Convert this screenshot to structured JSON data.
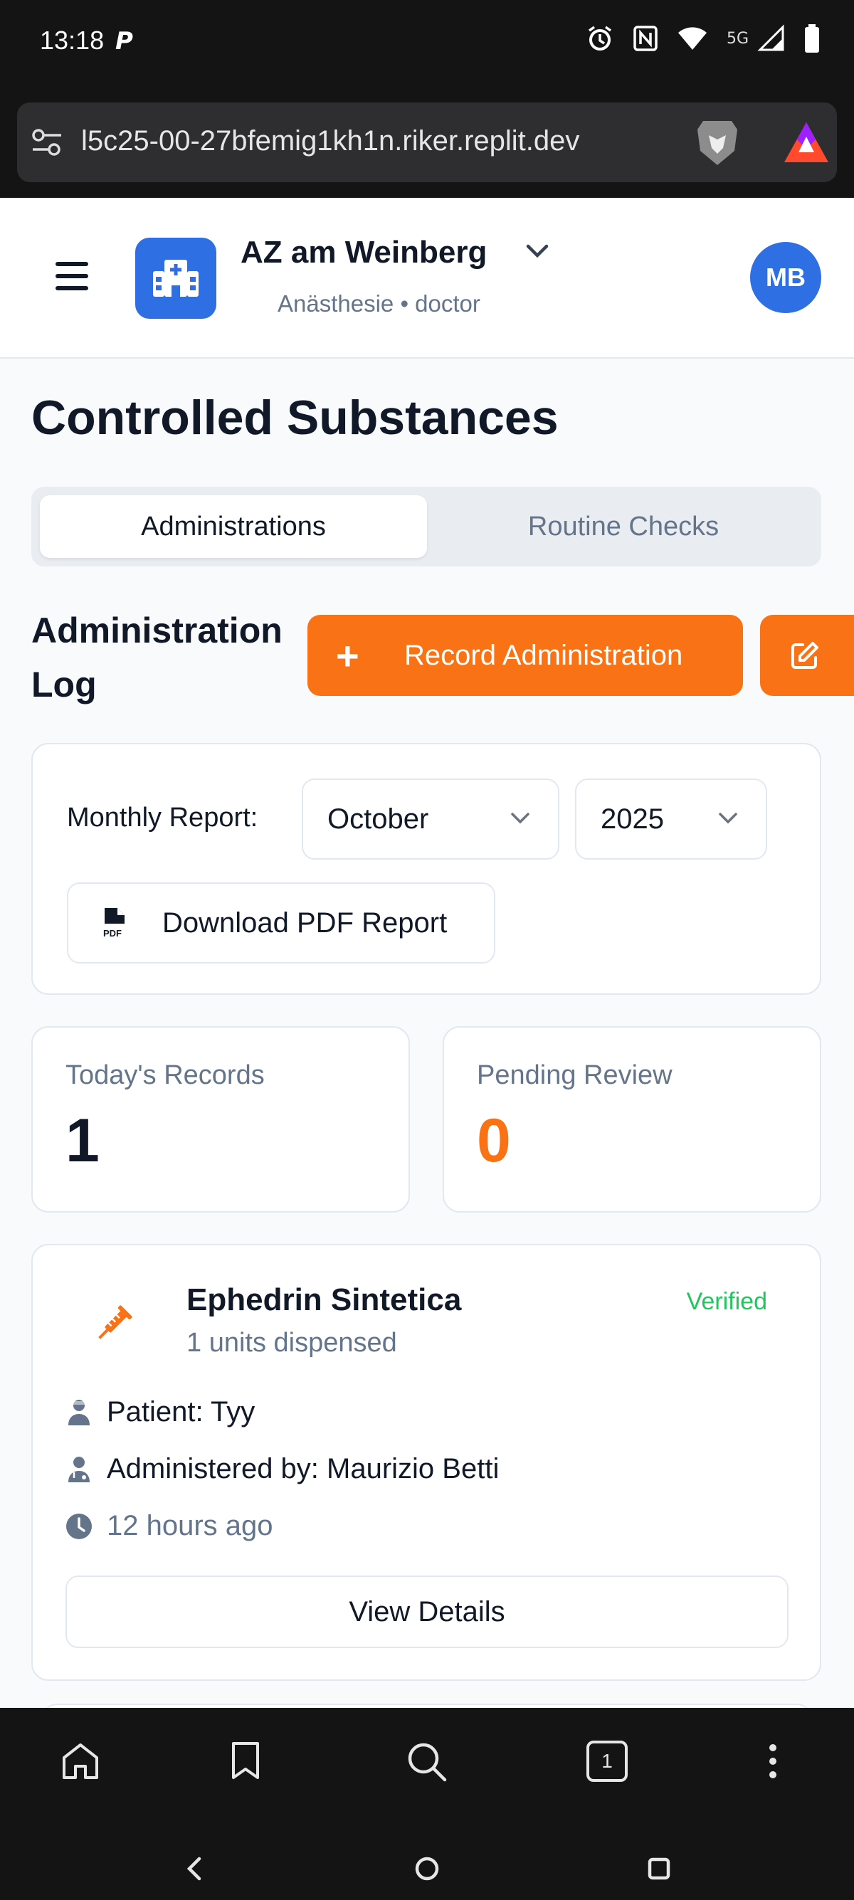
{
  "status_bar": {
    "time": "13:18",
    "network": "5G"
  },
  "browser": {
    "url": "l5c25-00-27bfemig1kh1n.riker.replit.dev"
  },
  "header": {
    "hospital_name": "AZ am Weinberg",
    "subtitle": "Anästhesie • doctor",
    "avatar_initials": "MB"
  },
  "page": {
    "title": "Controlled Substances"
  },
  "tabs": [
    {
      "label": "Administrations",
      "active": true
    },
    {
      "label": "Routine Checks",
      "active": false
    }
  ],
  "log": {
    "title": "Administration Log",
    "record_button": "Record Administration"
  },
  "report": {
    "label": "Monthly Report:",
    "month": "October",
    "year": "2025",
    "download_button": "Download PDF Report"
  },
  "stats": {
    "today_label": "Today's Records",
    "today_value": "1",
    "pending_label": "Pending Review",
    "pending_value": "0"
  },
  "records": [
    {
      "drug": "Ephedrin Sintetica",
      "quantity": "1 units dispensed",
      "status": "Verified",
      "patient": "Patient: Tyy",
      "administered_by": "Administered by: Maurizio Betti",
      "time": "12 hours ago",
      "details_button": "View Details"
    }
  ],
  "colors": {
    "accent_orange": "#f97316",
    "brand_blue": "#2f6fe4",
    "verified_green": "#22c55e"
  },
  "icons": [
    "paypal-icon",
    "alarm-icon",
    "nfc-icon",
    "wifi-icon",
    "signal-icon",
    "battery-icon",
    "tune-icon",
    "brave-lion-icon",
    "bat-icon",
    "menu-icon",
    "hospital-icon",
    "chevron-down-icon",
    "plus-icon",
    "edit-icon",
    "pdf-file-icon",
    "syringe-icon",
    "patient-icon",
    "doctor-icon",
    "clock-icon",
    "home-icon",
    "bookmark-icon",
    "search-icon",
    "tabs-icon",
    "more-icon",
    "back-icon",
    "home-circle-icon",
    "recents-icon"
  ],
  "bottom_bar": {
    "tab_count": "1"
  }
}
